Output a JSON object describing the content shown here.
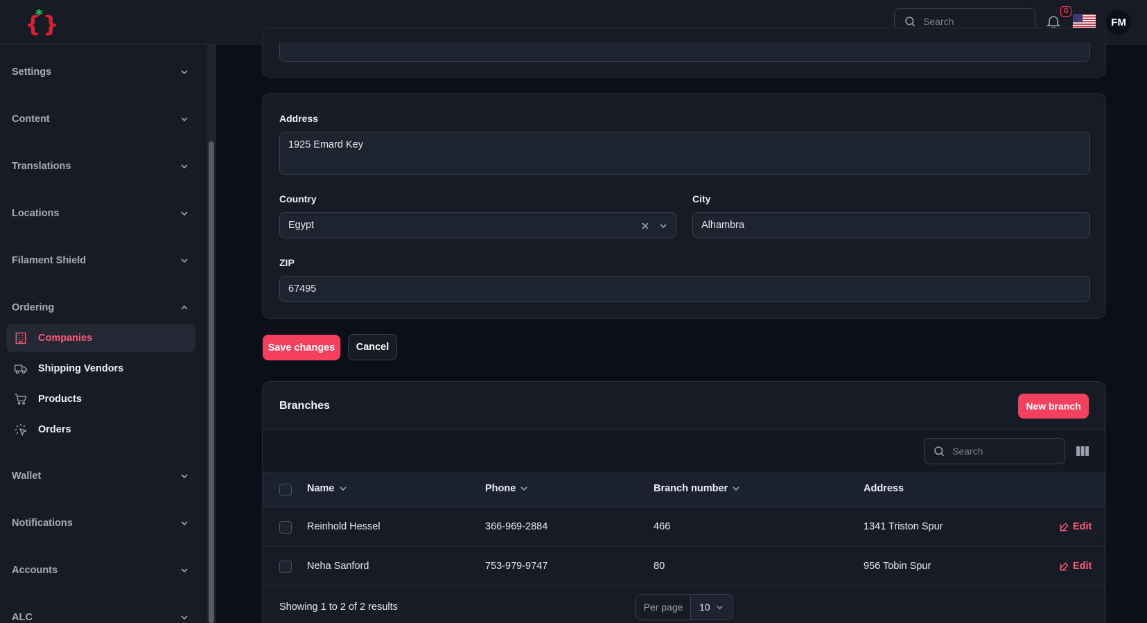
{
  "topbar": {
    "search_placeholder": "Search",
    "notifications_count": "0",
    "user_initials": "FM"
  },
  "sidebar": {
    "groups": [
      {
        "label": "Settings"
      },
      {
        "label": "Content"
      },
      {
        "label": "Translations"
      },
      {
        "label": "Locations"
      },
      {
        "label": "Filament Shield"
      },
      {
        "label": "Ordering"
      },
      {
        "label": "Wallet"
      },
      {
        "label": "Notifications"
      },
      {
        "label": "Accounts"
      },
      {
        "label": "ALC"
      }
    ],
    "ordering_items": [
      {
        "label": "Companies",
        "icon": "building-icon",
        "active": true
      },
      {
        "label": "Shipping Vendors",
        "icon": "truck-icon"
      },
      {
        "label": "Products",
        "icon": "cart-icon"
      },
      {
        "label": "Orders",
        "icon": "cursor-click-icon"
      }
    ]
  },
  "form": {
    "address_label": "Address",
    "address_value": "1925 Emard Key",
    "country_label": "Country",
    "country_value": "Egypt",
    "city_label": "City",
    "city_value": "Alhambra",
    "zip_label": "ZIP",
    "zip_value": "67495",
    "save_label": "Save changes",
    "cancel_label": "Cancel"
  },
  "branches": {
    "title": "Branches",
    "new_label": "New branch",
    "search_placeholder": "Search",
    "columns": [
      "Name",
      "Phone",
      "Branch number",
      "Address"
    ],
    "rows": [
      {
        "name": "Reinhold Hessel",
        "phone": "366-969-2884",
        "branch_number": "466",
        "address": "1341 Triston Spur",
        "action": "Edit"
      },
      {
        "name": "Neha Sanford",
        "phone": "753-979-9747",
        "branch_number": "80",
        "address": "956 Tobin Spur",
        "action": "Edit"
      }
    ],
    "summary": "Showing 1 to 2 of 2 results",
    "per_page_label": "Per page",
    "per_page_value": "10"
  },
  "colors": {
    "accent": "#f43f5e",
    "background": "#0b0f19",
    "surface": "#161b26"
  }
}
